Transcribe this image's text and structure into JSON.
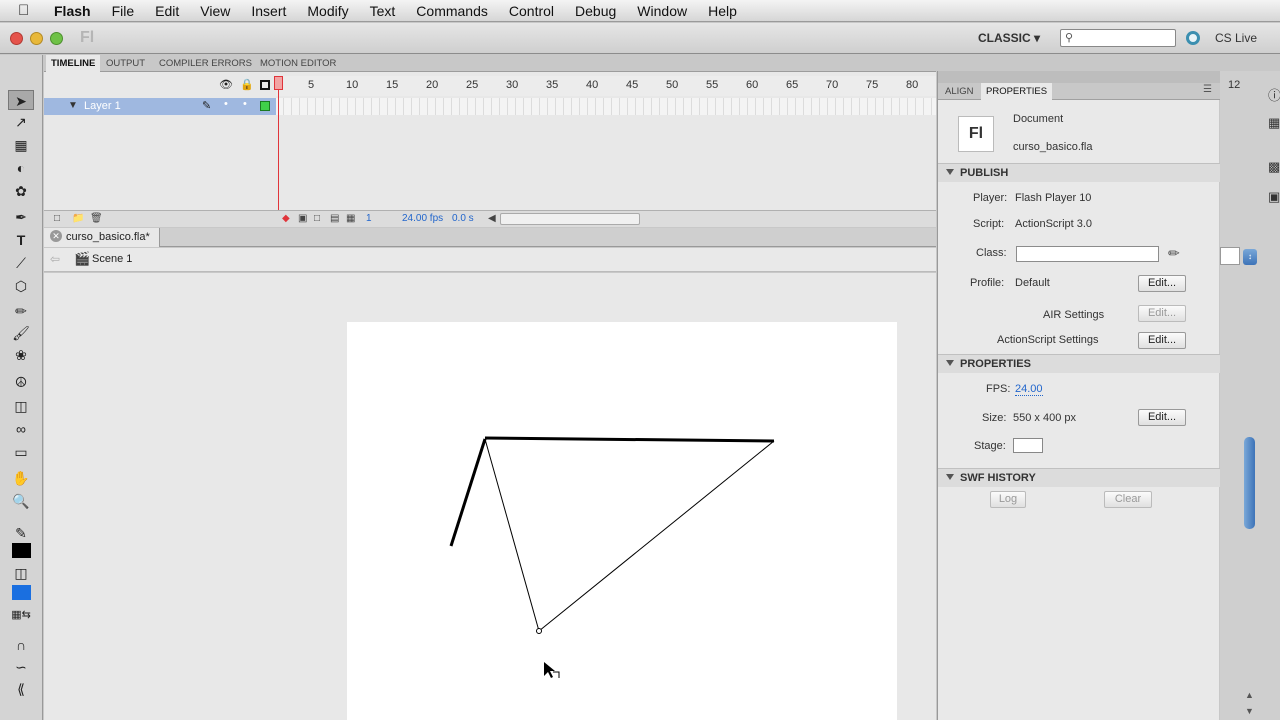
{
  "menubar": {
    "app_name": "Flash",
    "items": [
      "File",
      "Edit",
      "View",
      "Insert",
      "Modify",
      "Text",
      "Commands",
      "Control",
      "Debug",
      "Window",
      "Help"
    ]
  },
  "titlebar": {
    "app_mark": "Fl",
    "workspace": "CLASSIC ▾",
    "search_placeholder": "",
    "cs_live": "CS Live"
  },
  "timeline": {
    "tabs": [
      "TIMELINE",
      "OUTPUT",
      "COMPILER ERRORS",
      "MOTION EDITOR"
    ],
    "frame_numbers": [
      "5",
      "10",
      "15",
      "20",
      "25",
      "30",
      "35",
      "40",
      "45",
      "50",
      "55",
      "60",
      "65",
      "70",
      "75",
      "80"
    ],
    "layer_name": "Layer 1",
    "status": {
      "current_frame": "1",
      "fps": "24.00 fps",
      "time": "0.0 s"
    }
  },
  "document": {
    "tab_label": "curso_basico.fla*",
    "scene_label": "Scene 1"
  },
  "properties": {
    "tabs": [
      "ALIGN",
      "PROPERTIES"
    ],
    "doc_type": "Document",
    "doc_file": "curso_basico.fla",
    "doc_icon": "Fl",
    "publish": {
      "header": "PUBLISH",
      "player_label": "Player:",
      "player_value": "Flash Player 10",
      "script_label": "Script:",
      "script_value": "ActionScript 3.0",
      "class_label": "Class:",
      "class_value": "",
      "profile_label": "Profile:",
      "profile_value": "Default",
      "edit_label": "Edit...",
      "air_label": "AIR Settings",
      "as_label": "ActionScript Settings"
    },
    "props": {
      "header": "PROPERTIES",
      "fps_label": "FPS:",
      "fps_value": "24.00",
      "size_label": "Size:",
      "size_value": "550 x 400 px",
      "stage_label": "Stage:",
      "stage_color": "#ffffff"
    },
    "swf_history": {
      "header": "SWF HISTORY",
      "log_label": "Log",
      "clear_label": "Clear"
    }
  },
  "right_frame_number": "12",
  "colors": {
    "layer_highlight": "#9fb8e0",
    "playhead": "#e0343a",
    "fill_swatch": "#1a6fe0"
  }
}
